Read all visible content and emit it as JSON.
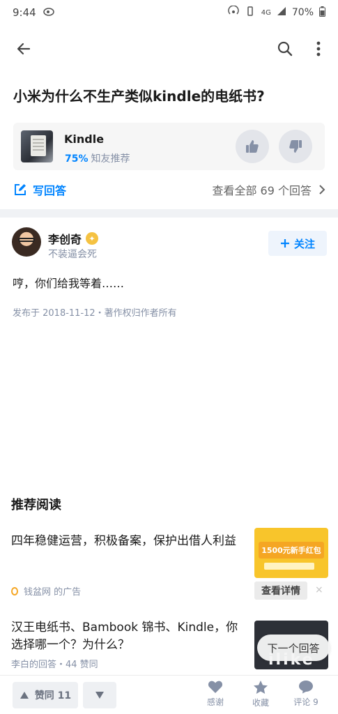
{
  "status": {
    "time": "9:44",
    "network": "4G",
    "battery": "70%"
  },
  "question": {
    "title": "小米为什么不生产类似kindle的电纸书?"
  },
  "product": {
    "name": "Kindle",
    "rating_pct": "75%",
    "rating_label": "知友推荐"
  },
  "answer_bar": {
    "write_label": "写回答",
    "view_all_label": "查看全部 69 个回答"
  },
  "author": {
    "name": "李创奇",
    "bio": "不装逼会死",
    "follow_label": "关注"
  },
  "answer": {
    "text": "哼，你们给我等着……",
    "meta": "发布于 2018-11-12・著作权归作者所有"
  },
  "recommend": {
    "heading": "推荐阅读",
    "ad": {
      "title": "四年稳健运营，积极备案，保护出借人利益",
      "source": "钱盆网 的广告",
      "image_text": "1500元新手红包",
      "detail_label": "查看详情",
      "close": "×"
    },
    "item2": {
      "title": "汉王电纸书、Bambook 锦书、Kindle，你选择哪一个？为什么？",
      "meta": "李白的回答・44 赞同",
      "image_text": "ilike"
    },
    "next_answer": "下一个回答"
  },
  "bottom_bar": {
    "upvote_label": "赞同 11",
    "thanks_label": "感谢",
    "favorite_label": "收藏",
    "comment_label": "评论 9"
  }
}
